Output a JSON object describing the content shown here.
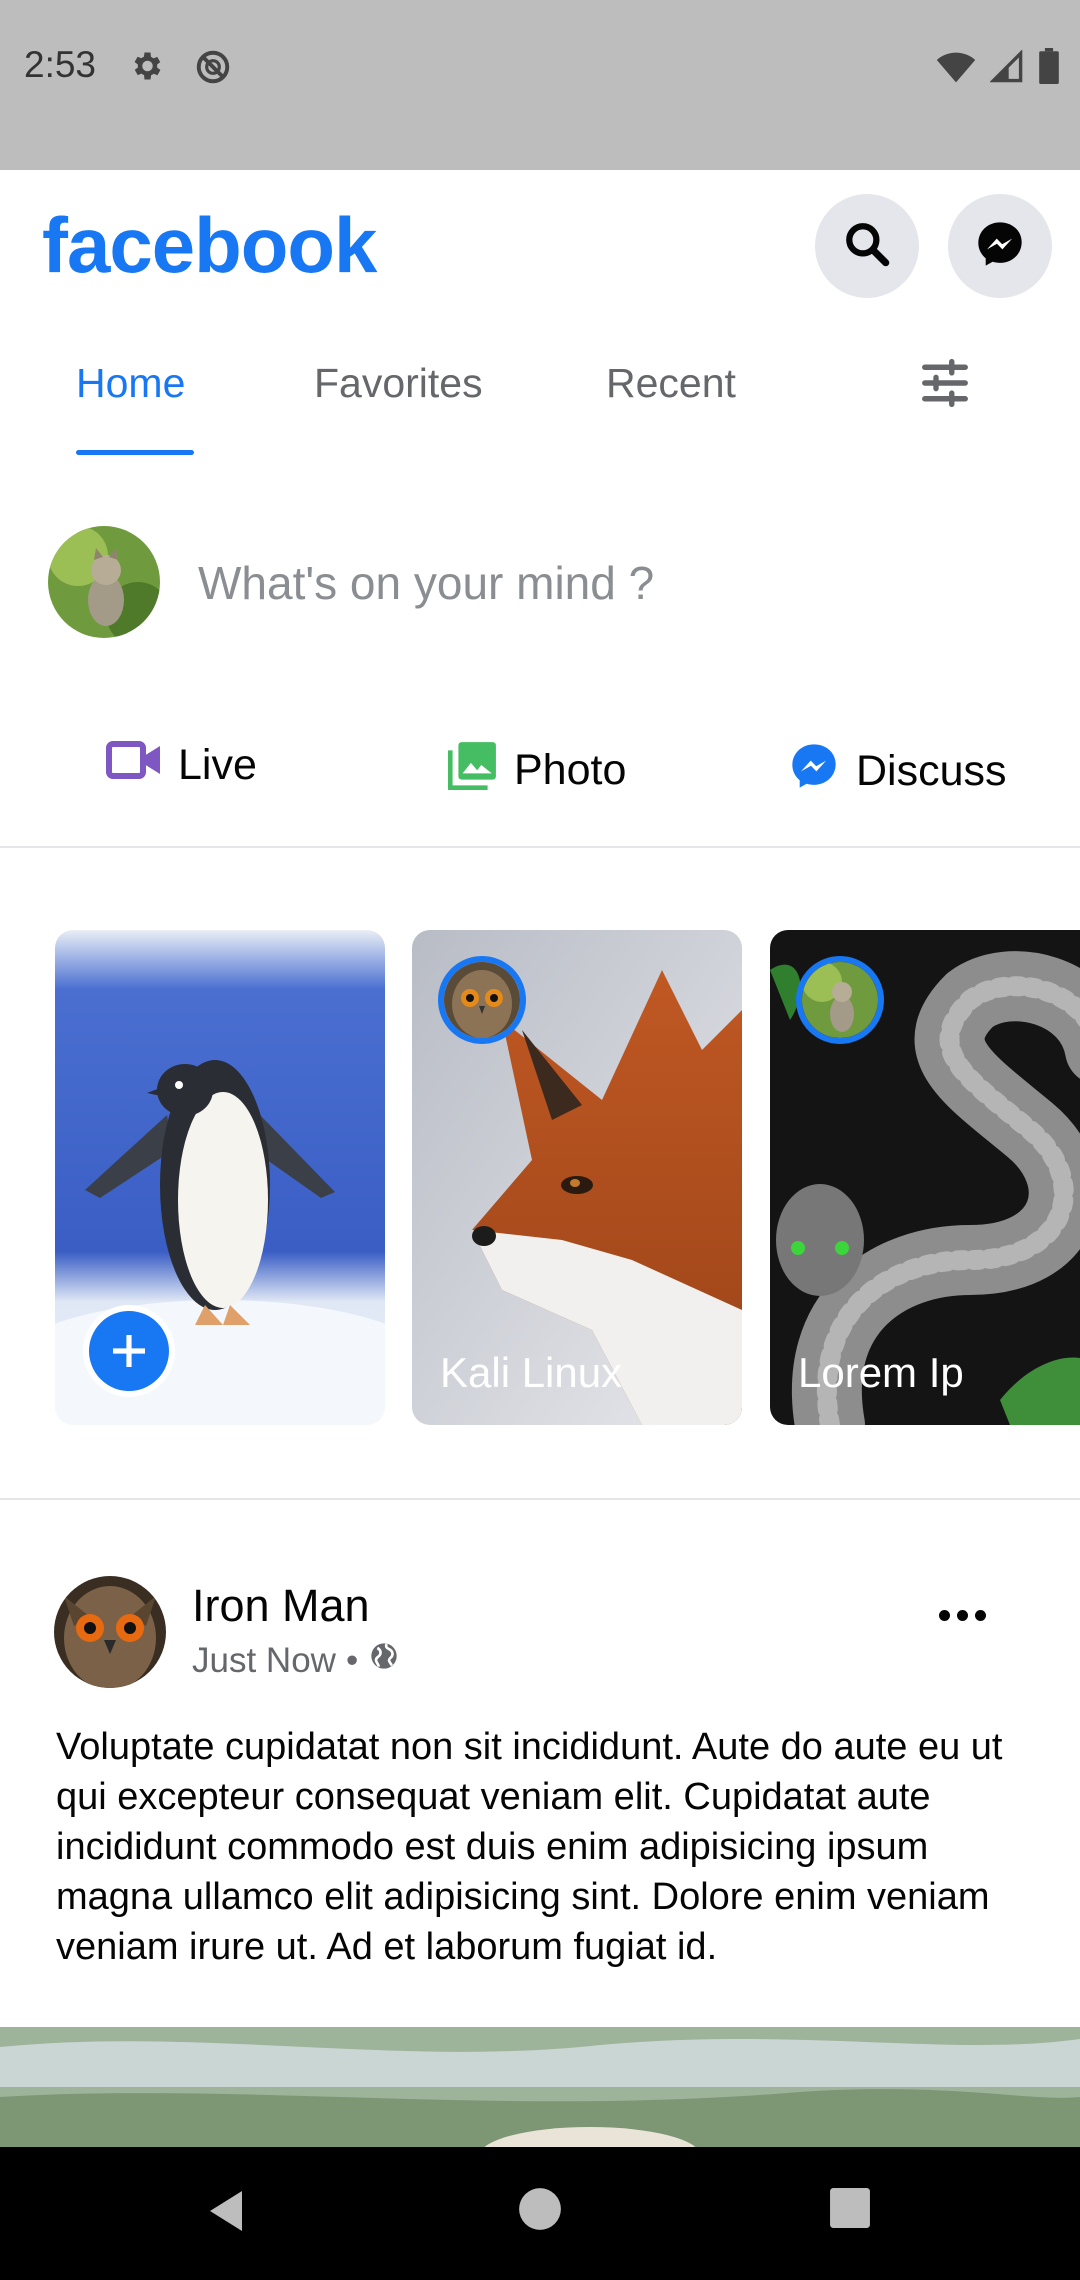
{
  "status_bar": {
    "time": "2:53",
    "icons": [
      "gear-icon",
      "do-not-disturb-icon",
      "wifi-icon",
      "signal-icon",
      "battery-icon"
    ]
  },
  "header": {
    "logo": "facebook",
    "search_icon": "search-icon",
    "messenger_icon": "messenger-icon"
  },
  "tabs": {
    "items": [
      {
        "label": "Home",
        "active": true
      },
      {
        "label": "Favorites",
        "active": false
      },
      {
        "label": "Recent",
        "active": false
      }
    ],
    "filter_icon": "sliders-icon"
  },
  "composer": {
    "placeholder": "What's on your mind ?",
    "actions": [
      {
        "label": "Live",
        "icon": "video-camera-icon",
        "color": "#7e57c2"
      },
      {
        "label": "Photo",
        "icon": "photo-gallery-icon",
        "color": "#45bd62"
      },
      {
        "label": "Discuss",
        "icon": "messenger-icon",
        "color": "#1877f2"
      }
    ]
  },
  "stories": [
    {
      "type": "create",
      "image": "penguin",
      "add_icon": "plus-icon"
    },
    {
      "type": "story",
      "name": "Kali Linux",
      "image": "fox",
      "avatar": "owl"
    },
    {
      "type": "story",
      "name": "Lorem Ip",
      "image": "snake",
      "avatar": "kitten"
    }
  ],
  "post": {
    "author": "Iron Man",
    "time": "Just Now",
    "separator": "•",
    "privacy_icon": "globe-icon",
    "text": "Voluptate cupidatat non sit incididunt. Aute do aute eu ut qui excepteur consequat veniam elit. Cupidatat aute incididunt commodo est duis enim adipisicing ipsum magna ullamco elit adipisicing sint. Dolore enim veniam veniam irure ut. Ad et laborum fugiat id."
  },
  "colors": {
    "brand": "#1877f2",
    "status_bar": "#bdbdbd",
    "nav_bar": "#000000"
  }
}
